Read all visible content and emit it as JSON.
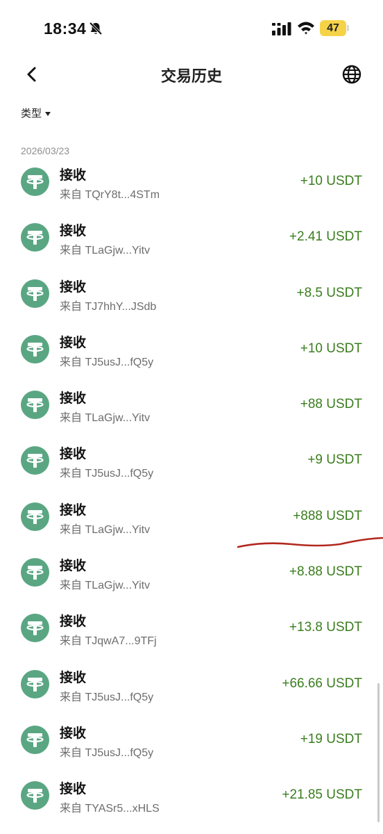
{
  "status_bar": {
    "time": "18:34",
    "battery": "47"
  },
  "header": {
    "title": "交易历史"
  },
  "filter": {
    "label": "类型"
  },
  "date_group": "2026/03/23",
  "colors": {
    "accent_green": "#3a7d1e",
    "tether_icon": "#5aa683",
    "annotation_red": "#b1281e"
  },
  "transactions": [
    {
      "type": "接收",
      "from": "来自 TQrY8t...4STm",
      "amount": "+10 USDT"
    },
    {
      "type": "接收",
      "from": "来自 TLaGjw...Yitv",
      "amount": "+2.41 USDT"
    },
    {
      "type": "接收",
      "from": "来自 TJ7hhY...JSdb",
      "amount": "+8.5 USDT"
    },
    {
      "type": "接收",
      "from": "来自 TJ5usJ...fQ5y",
      "amount": "+10 USDT"
    },
    {
      "type": "接收",
      "from": "来自 TLaGjw...Yitv",
      "amount": "+88 USDT"
    },
    {
      "type": "接收",
      "from": "来自 TJ5usJ...fQ5y",
      "amount": "+9 USDT"
    },
    {
      "type": "接收",
      "from": "来自 TLaGjw...Yitv",
      "amount": "+888 USDT"
    },
    {
      "type": "接收",
      "from": "来自 TLaGjw...Yitv",
      "amount": "+8.88 USDT"
    },
    {
      "type": "接收",
      "from": "来自 TJqwA7...9TFj",
      "amount": "+13.8 USDT"
    },
    {
      "type": "接收",
      "from": "来自 TJ5usJ...fQ5y",
      "amount": "+66.66 USDT"
    },
    {
      "type": "接收",
      "from": "来自 TJ5usJ...fQ5y",
      "amount": "+19 USDT"
    },
    {
      "type": "接收",
      "from": "来自 TYASr5...xHLS",
      "amount": "+21.85 USDT"
    }
  ]
}
